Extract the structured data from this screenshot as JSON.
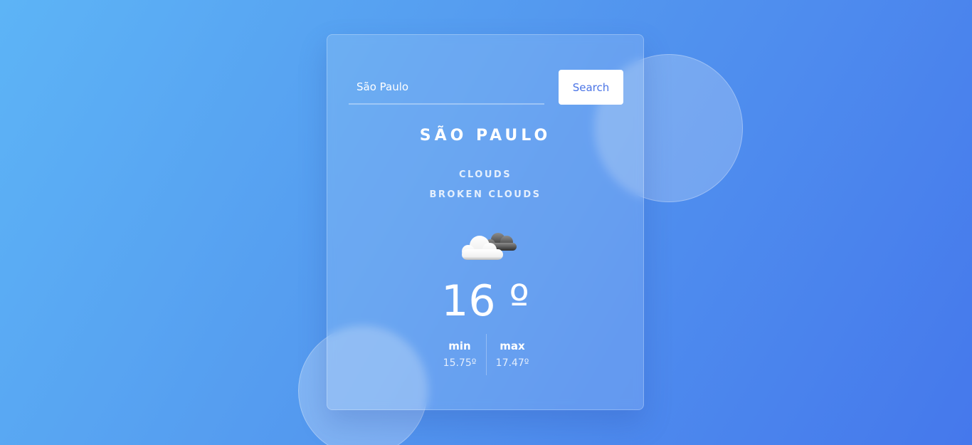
{
  "search": {
    "value": "São Paulo",
    "button_label": "Search"
  },
  "weather": {
    "city": "SÃO PAULO",
    "main": "CLOUDS",
    "description": "BROKEN CLOUDS",
    "icon": "broken-clouds-icon",
    "temperature": "16 º"
  },
  "range": {
    "min_label": "min",
    "min_value": "15.75º",
    "max_label": "max",
    "max_value": "17.47º"
  },
  "colors": {
    "background_start": "#5db4f6",
    "background_end": "#4578ec",
    "button_text": "#4a74e6"
  }
}
